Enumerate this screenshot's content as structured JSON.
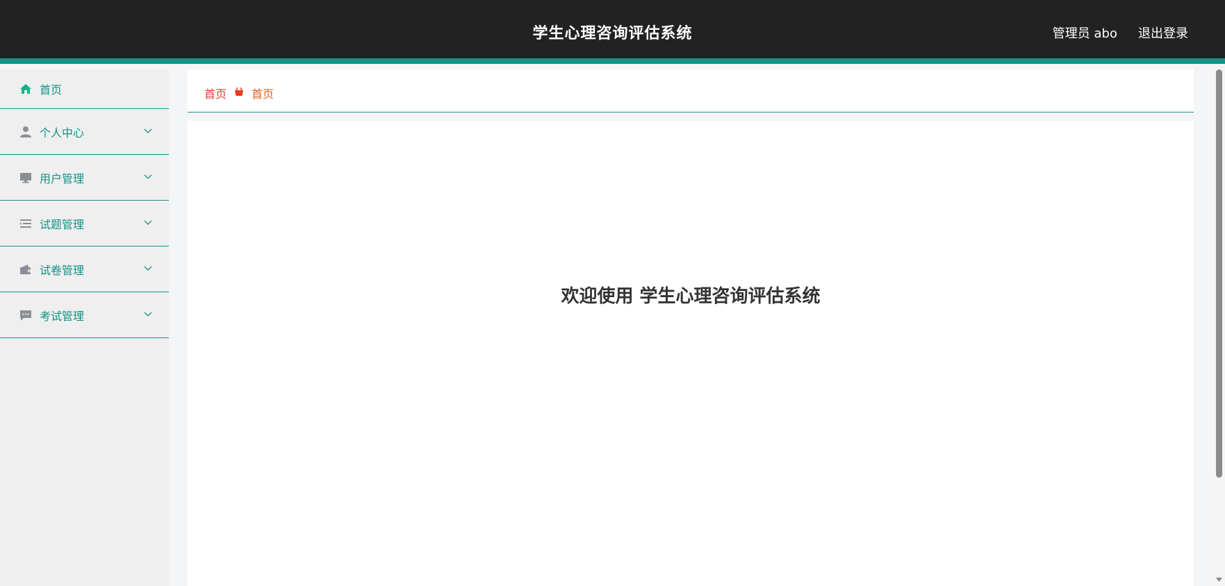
{
  "header": {
    "title": "学生心理咨询评估系统",
    "user": "管理员 abo",
    "logout": "退出登录"
  },
  "sidebar": {
    "items": [
      {
        "label": "首页",
        "icon": "home-icon"
      },
      {
        "label": "个人中心",
        "icon": "person-icon"
      },
      {
        "label": "用户管理",
        "icon": "monitor-icon"
      },
      {
        "label": "试题管理",
        "icon": "list-icon"
      },
      {
        "label": "试卷管理",
        "icon": "wallet-icon"
      },
      {
        "label": "考试管理",
        "icon": "chat-icon"
      }
    ]
  },
  "breadcrumb": {
    "home": "首页",
    "current": "首页"
  },
  "main": {
    "welcome": "欢迎使用 学生心理咨询评估系统"
  },
  "colors": {
    "header_bg": "#222222",
    "accent": "#149285",
    "breadcrumb_home": "#e53b3b",
    "breadcrumb_current": "#e2621f",
    "sidebar_bg": "#efefef"
  }
}
